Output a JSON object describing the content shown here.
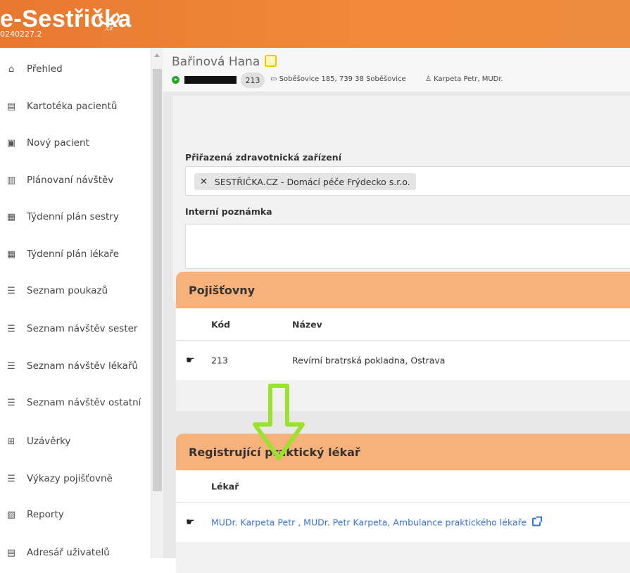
{
  "app": {
    "logo_text": "e-Sestřička",
    "logo_suffix": ".cz",
    "version": "0240227.2"
  },
  "sidebar": {
    "items": [
      {
        "label": "Přehled",
        "icon": "home-icon"
      },
      {
        "label": "Kartotéka pacientů",
        "icon": "card-index-icon"
      },
      {
        "label": "Nový pacient",
        "icon": "id-card-icon"
      },
      {
        "label": "Plánovaní návštěv",
        "icon": "map-icon"
      },
      {
        "label": "Týdenní plán sestry",
        "icon": "calendar-icon"
      },
      {
        "label": "Týdenní plán lékaře",
        "icon": "calendar-icon"
      },
      {
        "label": "Seznam poukazů",
        "icon": "list-icon"
      },
      {
        "label": "Seznam návštěv sester",
        "icon": "list-icon"
      },
      {
        "label": "Seznam návštěv lékařů",
        "icon": "list-icon"
      },
      {
        "label": "Seznam návštěv ostatní",
        "icon": "list-icon"
      },
      {
        "label": "Uzávěrky",
        "icon": "table-icon"
      },
      {
        "label": "Výkazy pojišťovně",
        "icon": "list-icon"
      },
      {
        "label": "Reporty",
        "icon": "report-icon"
      },
      {
        "label": "Adresář uživatelů",
        "icon": "address-book-icon"
      }
    ]
  },
  "patient": {
    "name": "Bařinová Hana",
    "insurance_badge": "213",
    "address": "Soběšovice 185, 739 38 Soběšovice",
    "doctor": "Karpeta Petr, MUDr.",
    "status_color": "#2aa52a"
  },
  "facilities": {
    "label": "Přiřazená zdravotnická zařízení",
    "tag": "SESTŘIČKA.CZ - Domácí péče Frýdecko s.r.o.",
    "remove_symbol": "✕"
  },
  "internal_note": {
    "label": "Interní poznámka",
    "value": ""
  },
  "insurers": {
    "title": "Pojišťovny",
    "columns": [
      "Kód",
      "Název"
    ],
    "rows": [
      {
        "code": "213",
        "name": "Revírní bratrská pokladna, Ostrava"
      }
    ]
  },
  "gp": {
    "title": "Registrující praktický lékař",
    "columns": [
      "Lékař"
    ],
    "rows": [
      {
        "doctor": "MUDr. Karpeta Petr , MUDr. Petr Karpeta, Ambulance praktického lékaře"
      }
    ]
  },
  "colors": {
    "topbar": "#ee8a3c",
    "card_header": "#f6b27a",
    "link": "#3a74d8",
    "arrow": "#9be22c"
  }
}
